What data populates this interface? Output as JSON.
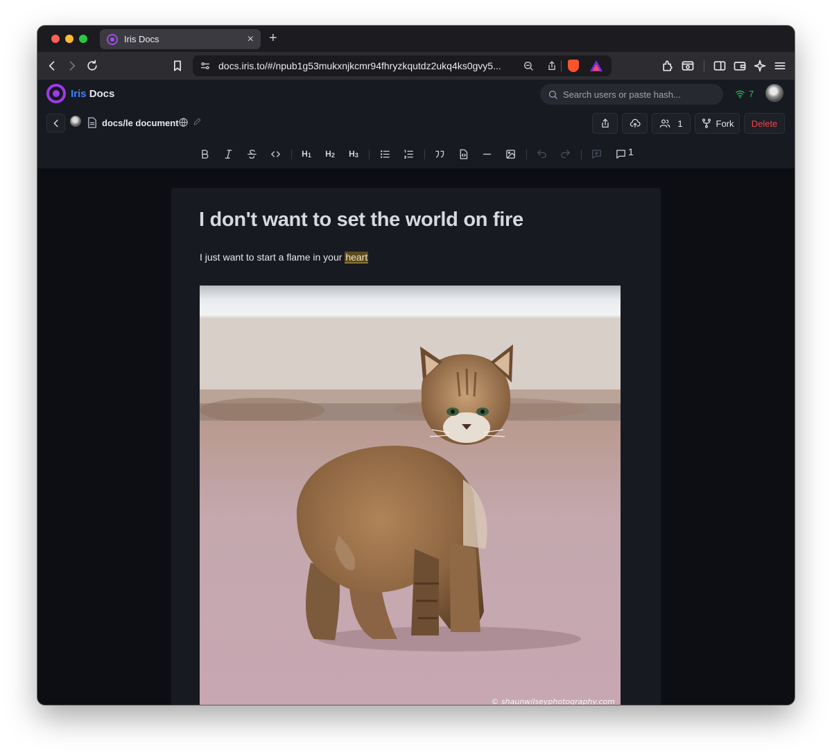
{
  "browser": {
    "tab_title": "Iris Docs",
    "tab_close": "×",
    "new_tab": "+",
    "url": "docs.iris.to/#/npub1g53mukxnjkcmr94fhryzkqutdz2ukq4ks0gvy5..."
  },
  "header": {
    "brand_part1": "Iris",
    "brand_part2": "Docs",
    "search_placeholder": "Search users or paste hash...",
    "peer_count": "7"
  },
  "doc_bar": {
    "path": "docs/le document",
    "collaborators_count": "1",
    "fork_label": "Fork",
    "delete_label": "Delete"
  },
  "format_bar": {
    "h1": "H",
    "h1_sub": "1",
    "h2": "H",
    "h2_sub": "2",
    "h3": "H",
    "h3_sub": "3",
    "comment_count": "1"
  },
  "document": {
    "title": "I don't want to set the world on fire",
    "para_before": "I just want to start a flame in your ",
    "para_highlight": "heart",
    "image_watermark": "© shaunwilseyphotography.com"
  },
  "colors": {
    "brand_purple": "#9d3bea",
    "brand_blue": "#3b82f6",
    "delete_red": "#ef4444",
    "peers_green": "#22c55e",
    "highlight_bg": "#5c4a1e"
  }
}
